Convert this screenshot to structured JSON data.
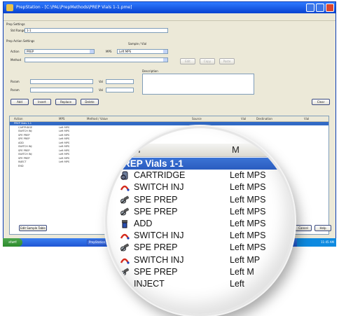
{
  "window": {
    "title": "PrepStation - [C:\\PAL\\PrepMethods\\PREP Vials 1-1.pme]"
  },
  "prep_settings": {
    "group_label": "Prep Settings",
    "name_label": "Std Range",
    "name_value": "1-1"
  },
  "action_settings": {
    "group_label": "Prep Action Settings",
    "sample_label": "Sample / Vial",
    "action_label": "Action",
    "action_value": "PREP",
    "mps_label": "MPS",
    "mps_value": "Left MPS",
    "method_label": "Method",
    "method_value": "",
    "description_label": "Description",
    "param1_label": "Param",
    "param2_label": "Param",
    "val_label": "Val"
  },
  "buttons": {
    "add": "Add",
    "insert": "Insert",
    "replace": "Replace",
    "delete": "Delete",
    "b1": "Edit",
    "b2": "Copy",
    "b3": "Paste",
    "clear": "Clear",
    "edit_sample_table": "Edit Sample Table",
    "ok": "OK",
    "cancel": "Cancel",
    "help": "Help"
  },
  "grid": {
    "columns": [
      "Action",
      "MPS",
      "Method / Value",
      "Source",
      "Vial",
      "Destination",
      "Vial"
    ],
    "rows": [
      {
        "action": "PREP Vials 1-1",
        "mps": "",
        "selected": true
      },
      {
        "action": "CARTRIDGE",
        "mps": "Left MPS"
      },
      {
        "action": "SWITCH INJ",
        "mps": "Left MPS"
      },
      {
        "action": "SPE PREP",
        "mps": "Left MPS"
      },
      {
        "action": "SPE PREP",
        "mps": "Left MPS"
      },
      {
        "action": "ADD",
        "mps": "Left MPS"
      },
      {
        "action": "SWITCH INJ",
        "mps": "Left MPS"
      },
      {
        "action": "SPE PREP",
        "mps": "Left MPS"
      },
      {
        "action": "SWITCH INJ",
        "mps": "Left MPS"
      },
      {
        "action": "SPE PREP",
        "mps": "Left MPS"
      },
      {
        "action": "INJECT",
        "mps": "Left MPS"
      },
      {
        "action": "END",
        "mps": ""
      }
    ]
  },
  "magnifier": {
    "header_action": "ion",
    "header_mps": "M",
    "rows": [
      {
        "name": "PREP Vials 1-1",
        "loc": "",
        "icon": "folder-icon",
        "selected": true
      },
      {
        "name": "CARTRIDGE",
        "loc": "Left MPS",
        "icon": "cartridge-icon"
      },
      {
        "name": "SWITCH INJ",
        "loc": "Left MPS",
        "icon": "switch-inj-icon"
      },
      {
        "name": "SPE PREP",
        "loc": "Left MPS",
        "icon": "spe-prep-icon"
      },
      {
        "name": "SPE PREP",
        "loc": "Left MPS",
        "icon": "spe-prep-icon"
      },
      {
        "name": "ADD",
        "loc": "Left MPS",
        "icon": "add-icon"
      },
      {
        "name": "SWITCH INJ",
        "loc": "Left MPS",
        "icon": "switch-inj-icon"
      },
      {
        "name": "SPE PREP",
        "loc": "Left MPS",
        "icon": "spe-prep-icon"
      },
      {
        "name": "SWITCH INJ",
        "loc": "Left MP",
        "icon": "switch-inj-icon"
      },
      {
        "name": "SPE PREP",
        "loc": "Left M",
        "icon": "spe-prep-icon"
      },
      {
        "name": "INJECT",
        "loc": "Left",
        "icon": "inject-icon"
      },
      {
        "name": "P",
        "loc": "",
        "icon": "end-icon"
      }
    ]
  },
  "taskbar": {
    "start_label": "start",
    "tasks": [
      "PrepStation",
      "Data Acquisition",
      "Method"
    ],
    "clock": "11:45 AM"
  },
  "colors": {
    "selection": "#316ac5",
    "titlebar": "#0842d0",
    "switch_icon": "#d52b1e",
    "spe_icon": "#333333"
  }
}
